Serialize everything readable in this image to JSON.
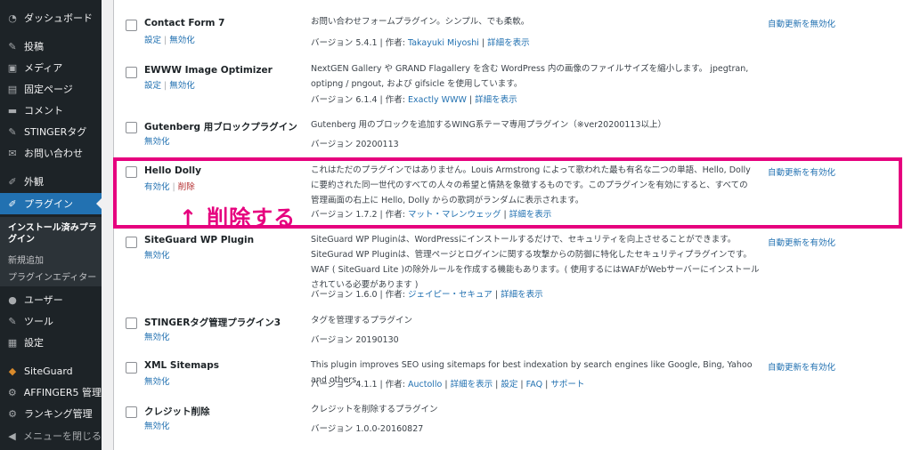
{
  "sidebar": {
    "items": [
      {
        "label": "ダッシュボード",
        "icon": "dashboard-icon",
        "glyph": "◔"
      },
      {
        "label": "投稿",
        "icon": "pin-icon",
        "glyph": "✎"
      },
      {
        "label": "メディア",
        "icon": "media-icon",
        "glyph": "▣"
      },
      {
        "label": "固定ページ",
        "icon": "page-icon",
        "glyph": "▤"
      },
      {
        "label": "コメント",
        "icon": "comment-icon",
        "glyph": "▬"
      },
      {
        "label": "STINGERタグ",
        "icon": "pin-icon",
        "glyph": "✎"
      },
      {
        "label": "お問い合わせ",
        "icon": "mail-icon",
        "glyph": "✉"
      },
      {
        "label": "外観",
        "icon": "appearance-icon",
        "glyph": "✐"
      },
      {
        "label": "プラグイン",
        "icon": "plugin-icon",
        "glyph": "✐"
      },
      {
        "label": "ユーザー",
        "icon": "user-icon",
        "glyph": "●"
      },
      {
        "label": "ツール",
        "icon": "wrench-icon",
        "glyph": "✎"
      },
      {
        "label": "設定",
        "icon": "settings-icon",
        "glyph": "▦"
      },
      {
        "label": "SiteGuard",
        "icon": "siteguard-icon",
        "glyph": "◆"
      },
      {
        "label": "AFFINGER5 管理",
        "icon": "gear-icon",
        "glyph": "⚙"
      },
      {
        "label": "ランキング管理",
        "icon": "gear-icon",
        "glyph": "⚙"
      },
      {
        "label": "メニューを閉じる",
        "icon": "collapse-icon",
        "glyph": "◀"
      }
    ],
    "submenu": [
      {
        "label": "インストール済みプラグイン"
      },
      {
        "label": "新規追加"
      },
      {
        "label": "プラグインエディター"
      }
    ]
  },
  "plugins": [
    {
      "name": "Contact Form 7",
      "actions": [
        "設定",
        "無効化"
      ],
      "desc": "お問い合わせフォームプラグイン。シンプル、でも柔軟。",
      "version": "バージョン 5.4.1",
      "author_prefix": "作者:",
      "author": "Takayuki Miyoshi",
      "links": [
        "詳細を表示"
      ],
      "auto_update": "自動更新を無効化"
    },
    {
      "name": "EWWW Image Optimizer",
      "actions": [
        "設定",
        "無効化"
      ],
      "desc": "NextGEN Gallery や GRAND Flagallery を含む WordPress 内の画像のファイルサイズを縮小します。 jpegtran, optipng / pngout, および gifsicle を使用しています。",
      "version": "バージョン 6.1.4",
      "author_prefix": "作者:",
      "author": "Exactly WWW",
      "links": [
        "詳細を表示"
      ],
      "auto_update": ""
    },
    {
      "name": "Gutenberg 用ブロックプラグイン",
      "actions": [
        "無効化"
      ],
      "desc": "Gutenberg 用のブロックを追加するWING系テーマ専用プラグイン（※ver20200113以上）",
      "version": "バージョン 20200113",
      "author_prefix": "",
      "author": "",
      "links": [],
      "auto_update": ""
    },
    {
      "name": "Hello Dolly",
      "actions": [
        "有効化",
        "削除"
      ],
      "desc": "これはただのプラグインではありません。Louis Armstrong によって歌われた最も有名な二つの単語、Hello, Dolly に要約された同一世代のすべての人々の希望と情熱を象徴するものです。このプラグインを有効にすると、すべての管理画面の右上に Hello, Dolly からの歌詞がランダムに表示されます。",
      "version": "バージョン 1.7.2",
      "author_prefix": "作者:",
      "author": "マット・マレンウェッグ",
      "links": [
        "詳細を表示"
      ],
      "auto_update": "自動更新を有効化"
    },
    {
      "name": "SiteGuard WP Plugin",
      "actions": [
        "無効化"
      ],
      "desc": "SiteGuard WP Pluginは、WordPressにインストールするだけで、セキュリティを向上させることができます。SiteGurad WP Pluginは、管理ページとログインに関する攻撃からの防御に特化したセキュリティプラグインです。WAF ( SiteGuard Lite )の除外ルールを作成する機能もあります。( 使用するにはWAFがWebサーバーにインストールされている必要があります )",
      "version": "バージョン 1.6.0",
      "author_prefix": "作者:",
      "author": "ジェイピー・セキュア",
      "links": [
        "詳細を表示"
      ],
      "auto_update": "自動更新を有効化"
    },
    {
      "name": "STINGERタグ管理プラグイン3",
      "actions": [
        "無効化"
      ],
      "desc": "タグを管理するプラグイン",
      "version": "バージョン 20190130",
      "author_prefix": "",
      "author": "",
      "links": [],
      "auto_update": ""
    },
    {
      "name": "XML Sitemaps",
      "actions": [
        "無効化"
      ],
      "desc": "This plugin improves SEO using sitemaps for best indexation by search engines like Google, Bing, Yahoo and others.",
      "version": "バージョン 4.1.1",
      "author_prefix": "作者:",
      "author": "Auctollo",
      "links": [
        "詳細を表示",
        "設定",
        "FAQ",
        "サポート"
      ],
      "auto_update": "自動更新を有効化"
    },
    {
      "name": "クレジット削除",
      "actions": [
        "無効化"
      ],
      "desc": "クレジットを削除するプラグイン",
      "version": "バージョン 1.0.0-20160827",
      "author_prefix": "",
      "author": "",
      "links": [],
      "auto_update": ""
    }
  ],
  "annotation": {
    "arrow": "↑",
    "text": "削除する"
  },
  "colors": {
    "sidebar_bg": "#1d2327",
    "active_menu": "#2271b1",
    "link": "#2271b1",
    "delete": "#b32d2e",
    "highlight": "#e6007e"
  }
}
